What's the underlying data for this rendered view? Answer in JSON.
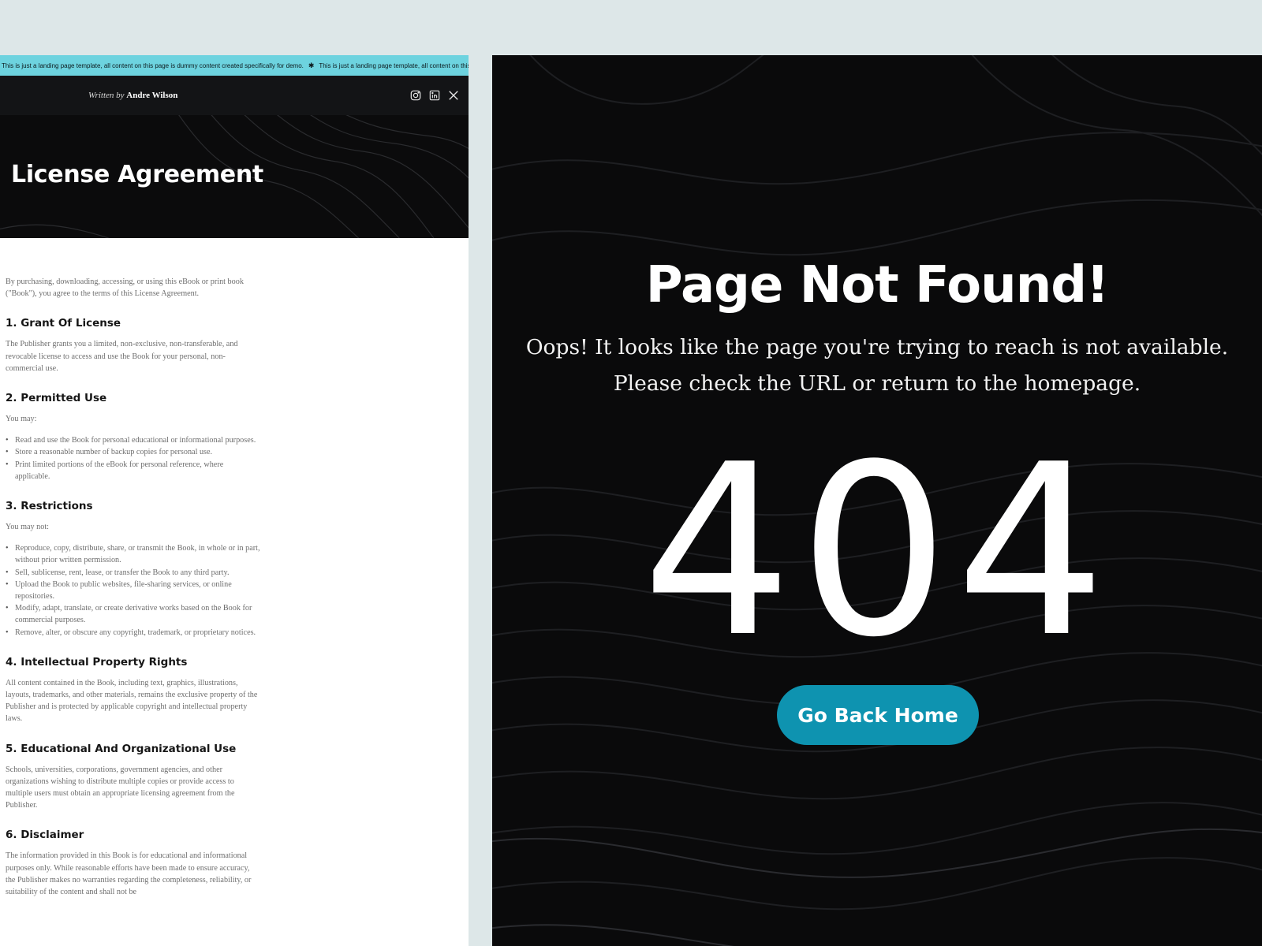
{
  "license_page": {
    "ticker_text": "This is just a landing page template, all content on this page is dummy content created specifically for demo.",
    "byline": {
      "prefix": "Written by",
      "author": "Andre Wilson"
    },
    "hero_title": "License Agreement",
    "intro": "By purchasing, downloading, accessing, or using this eBook or print book (\"Book\"), you agree to the terms of this License Agreement.",
    "sections": [
      {
        "heading": "1. Grant Of License",
        "text": "The Publisher grants you a limited, non-exclusive, non-transferable, and revocable license to access and use the Book for your personal, non-commercial use."
      },
      {
        "heading": "2. Permitted Use",
        "text": "You may:",
        "items": [
          "Read and use the Book for personal educational or informational purposes.",
          "Store a reasonable number of backup copies for personal use.",
          "Print limited portions of the eBook for personal reference, where applicable."
        ]
      },
      {
        "heading": "3. Restrictions",
        "text": "You may not:",
        "items": [
          "Reproduce, copy, distribute, share, or transmit the Book, in whole or in part, without prior written permission.",
          "Sell, sublicense, rent, lease, or transfer the Book to any third party.",
          "Upload the Book to public websites, file-sharing services, or online repositories.",
          "Modify, adapt, translate, or create derivative works based on the Book for commercial purposes.",
          "Remove, alter, or obscure any copyright, trademark, or proprietary notices."
        ]
      },
      {
        "heading": "4. Intellectual Property Rights",
        "text": "All content contained in the Book, including text, graphics, illustrations, layouts, trademarks, and other materials, remains the exclusive property of the Publisher and is protected by applicable copyright and intellectual property laws."
      },
      {
        "heading": "5. Educational And Organizational Use",
        "text": "Schools, universities, corporations, government agencies, and other organizations wishing to distribute multiple copies or provide access to multiple users must obtain an appropriate licensing agreement from the Publisher."
      },
      {
        "heading": "6. Disclaimer",
        "text": "The information provided in this Book is for educational and informational purposes only. While reasonable efforts have been made to ensure accuracy, the Publisher makes no warranties regarding the completeness, reliability, or suitability of the content and shall not be"
      }
    ],
    "social_icons": [
      "instagram-icon",
      "linkedin-icon",
      "x-icon"
    ],
    "colors": {
      "ticker_bg": "#6dd3df",
      "header_bg": "#131416",
      "hero_bg": "#0b0b0c"
    }
  },
  "not_found_page": {
    "title": "Page Not Found!",
    "message_line1": "Oops! It looks like the page you're trying to reach is not available.",
    "message_line2": "Please check the URL or return to the homepage.",
    "code": "404",
    "button_label": "Go Back Home",
    "colors": {
      "background": "#0a0a0b",
      "button": "#0e93b0"
    }
  }
}
